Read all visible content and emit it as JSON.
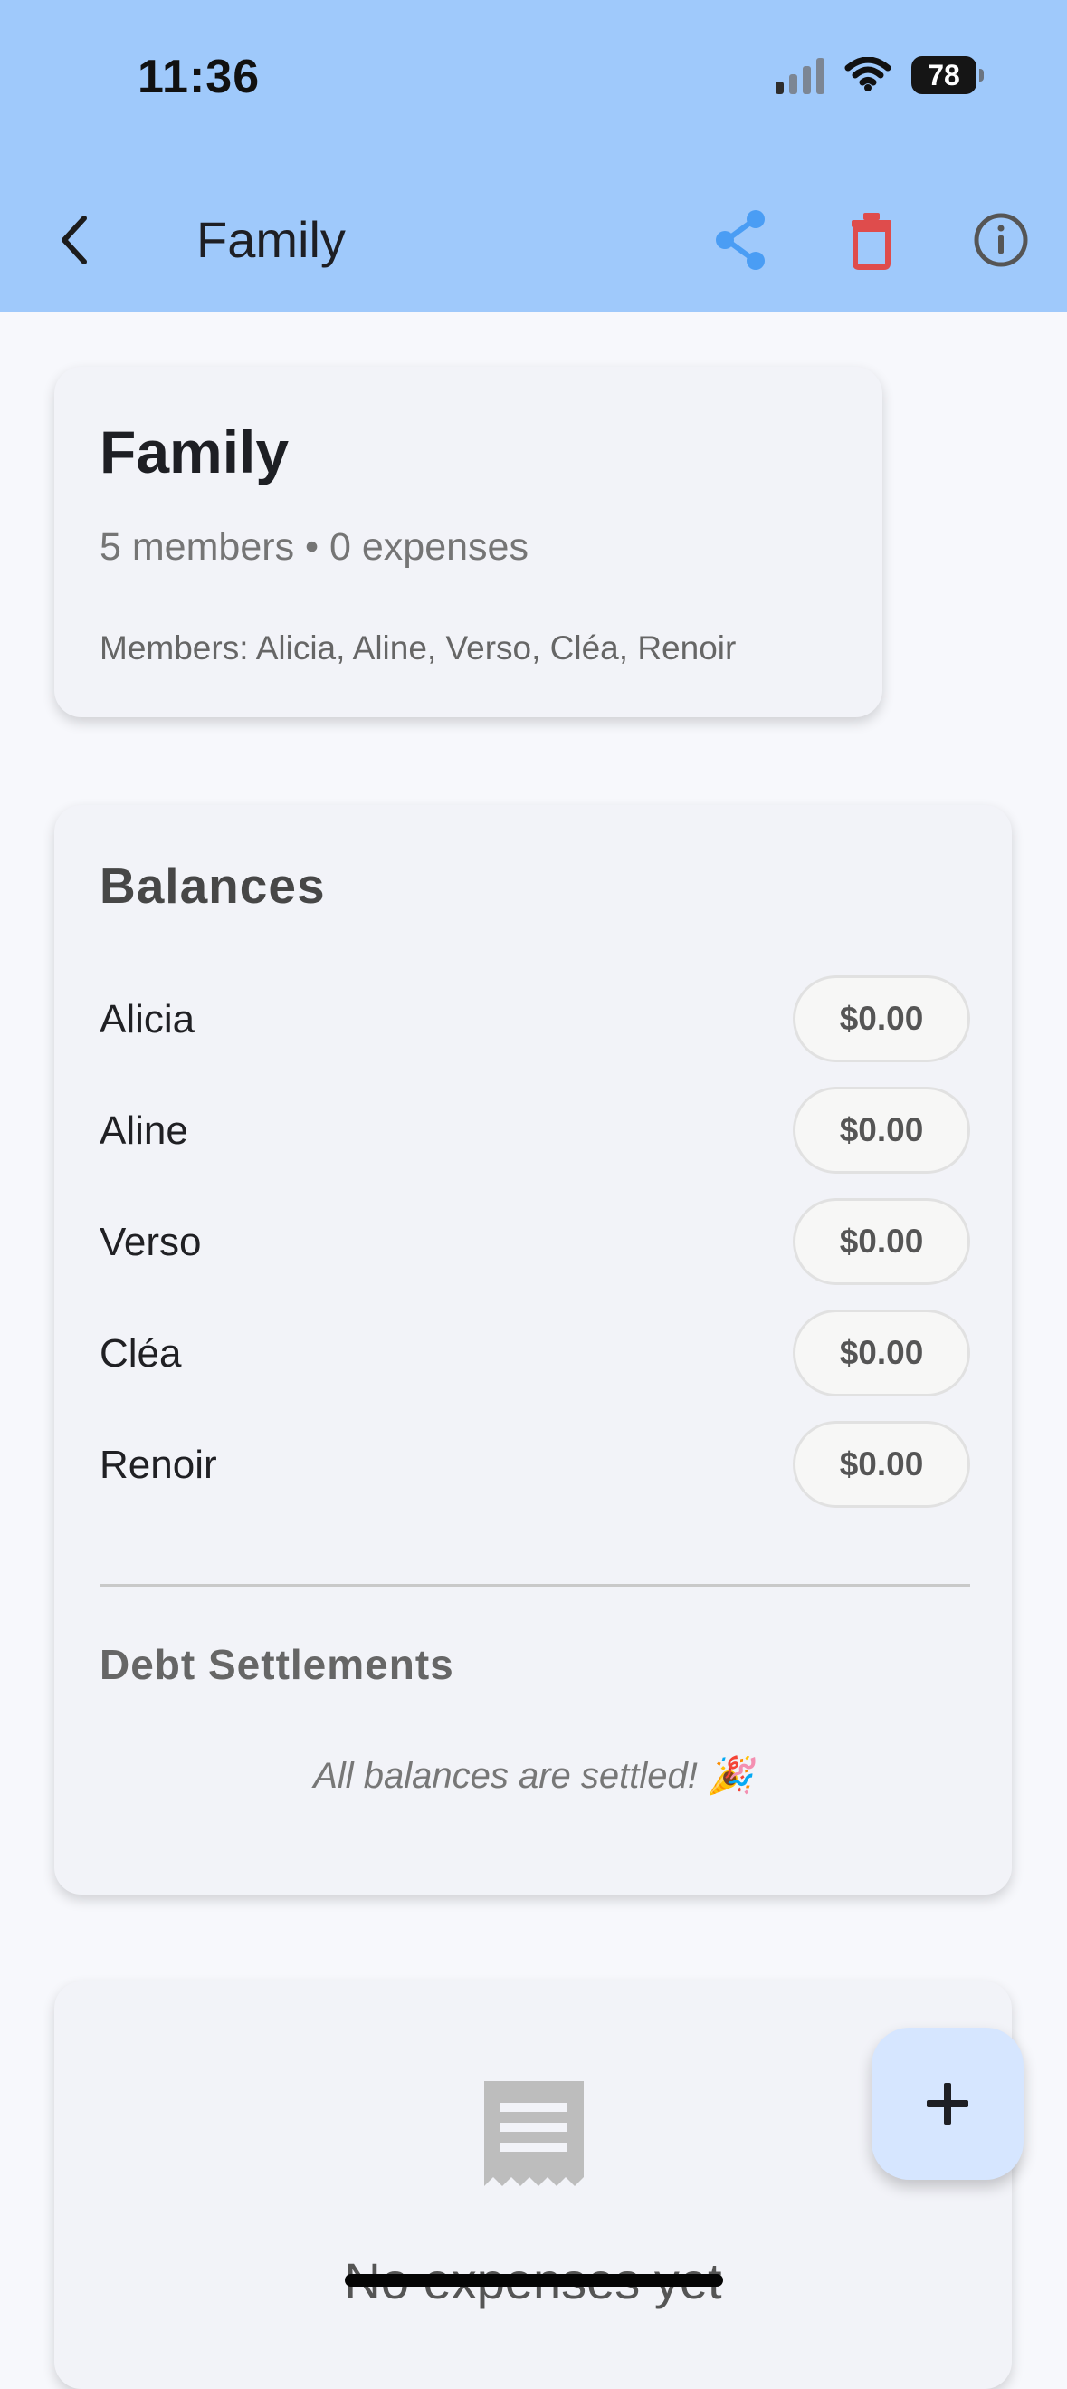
{
  "status_bar": {
    "time": "11:36",
    "battery": "78",
    "icons": [
      "signal-icon",
      "wifi-icon",
      "battery-icon"
    ]
  },
  "header": {
    "title": "Family",
    "back_icon": "chevron-left-icon",
    "actions": [
      "share-icon",
      "trash-icon",
      "info-icon"
    ],
    "colors": {
      "background": "#9fc9fb",
      "share": "#4a9df4",
      "delete": "#df4c4c",
      "info": "#555555"
    }
  },
  "group_summary": {
    "name": "Family",
    "meta": "5 members • 0 expenses",
    "members_text": "Members: Alicia, Aline, Verso, Cléa, Renoir"
  },
  "balances": {
    "title": "Balances",
    "items": [
      {
        "name": "Alicia",
        "amount": "$0.00"
      },
      {
        "name": "Aline",
        "amount": "$0.00"
      },
      {
        "name": "Verso",
        "amount": "$0.00"
      },
      {
        "name": "Cléa",
        "amount": "$0.00"
      },
      {
        "name": "Renoir",
        "amount": "$0.00"
      }
    ],
    "debt_title": "Debt Settlements",
    "settled_text": "All balances are settled! 🎉"
  },
  "expenses": {
    "empty_text": "No expenses yet",
    "icon": "receipt-icon"
  },
  "fab": {
    "icon": "plus-icon",
    "label": "+"
  }
}
